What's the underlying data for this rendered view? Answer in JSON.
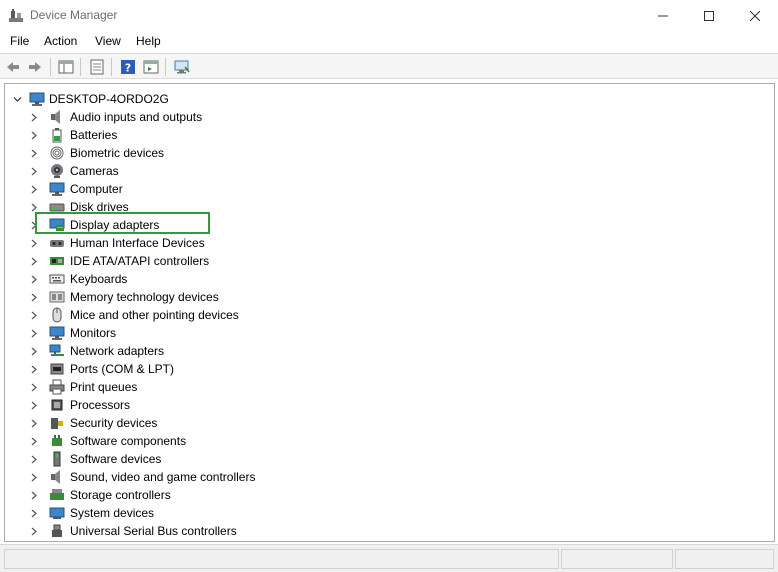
{
  "window": {
    "title": "Device Manager",
    "icon": "device-manager-icon",
    "controls": [
      "minimize-icon",
      "maximize-icon",
      "close-icon"
    ]
  },
  "menu": {
    "file": "File",
    "action": "Action",
    "view": "View",
    "help": "Help"
  },
  "toolbar": {
    "buttons": [
      "back-icon",
      "forward-icon",
      "show-hide-console-tree-icon",
      "properties-icon",
      "help-icon",
      "action-pane-icon",
      "scan-hardware-icon"
    ]
  },
  "tree": {
    "root": {
      "label": "DESKTOP-4ORDO2G",
      "expanded": true,
      "icon": "computer-icon"
    },
    "items": [
      {
        "label": "Audio inputs and outputs",
        "icon": "speaker-icon"
      },
      {
        "label": "Batteries",
        "icon": "battery-icon"
      },
      {
        "label": "Biometric devices",
        "icon": "fingerprint-icon"
      },
      {
        "label": "Cameras",
        "icon": "camera-icon"
      },
      {
        "label": "Computer",
        "icon": "monitor-icon"
      },
      {
        "label": "Disk drives",
        "icon": "disk-drive-icon"
      },
      {
        "label": "Display adapters",
        "icon": "display-adapter-icon",
        "highlighted": true
      },
      {
        "label": "Human Interface Devices",
        "icon": "hid-icon"
      },
      {
        "label": "IDE ATA/ATAPI controllers",
        "icon": "ide-controller-icon"
      },
      {
        "label": "Keyboards",
        "icon": "keyboard-icon"
      },
      {
        "label": "Memory technology devices",
        "icon": "memory-icon"
      },
      {
        "label": "Mice and other pointing devices",
        "icon": "mouse-icon"
      },
      {
        "label": "Monitors",
        "icon": "monitor-icon"
      },
      {
        "label": "Network adapters",
        "icon": "network-icon"
      },
      {
        "label": "Ports (COM & LPT)",
        "icon": "port-icon"
      },
      {
        "label": "Print queues",
        "icon": "printer-icon"
      },
      {
        "label": "Processors",
        "icon": "processor-icon"
      },
      {
        "label": "Security devices",
        "icon": "security-icon"
      },
      {
        "label": "Software components",
        "icon": "software-component-icon"
      },
      {
        "label": "Software devices",
        "icon": "software-device-icon"
      },
      {
        "label": "Sound, video and game controllers",
        "icon": "sound-icon"
      },
      {
        "label": "Storage controllers",
        "icon": "storage-icon"
      },
      {
        "label": "System devices",
        "icon": "system-device-icon"
      },
      {
        "label": "Universal Serial Bus controllers",
        "icon": "usb-icon"
      }
    ]
  },
  "colors": {
    "highlight_border": "#2e9c3d",
    "title_text": "#6d6d6d",
    "accent_blue": "#1e88d4"
  }
}
